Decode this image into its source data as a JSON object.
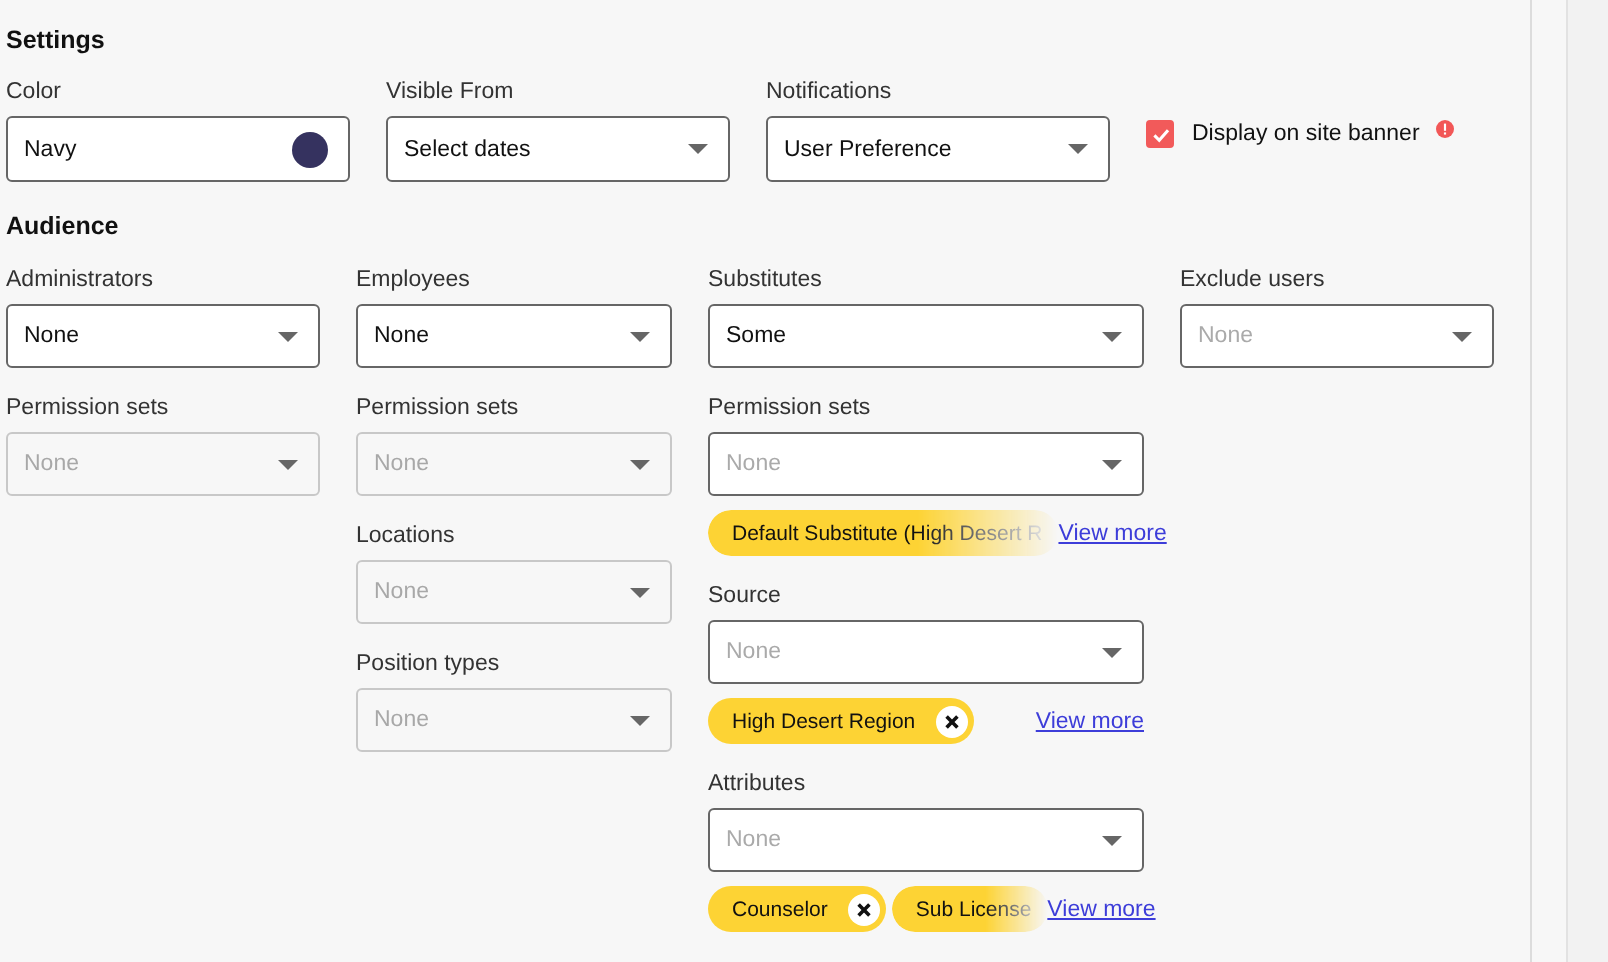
{
  "settings": {
    "title": "Settings",
    "fields": [
      {
        "kind": "color",
        "label": "Color",
        "value": "Navy",
        "color": "#35325f"
      },
      {
        "kind": "select",
        "label": "Visible From",
        "value": "Select dates"
      },
      {
        "kind": "select",
        "label": "Notifications",
        "value": "User Preference"
      }
    ],
    "banner": {
      "label": "Display on site banner",
      "checked": true
    }
  },
  "audience": {
    "title": "Audience",
    "columns": [
      [
        {
          "label": "Administrators",
          "value": "None",
          "disabled": false
        },
        {
          "label": "Permission sets",
          "placeholder": "None",
          "disabled": true
        }
      ],
      [
        {
          "label": "Employees",
          "value": "None",
          "disabled": false
        },
        {
          "label": "Permission sets",
          "placeholder": "None",
          "disabled": true
        },
        {
          "label": "Locations",
          "placeholder": "None",
          "disabled": true
        },
        {
          "label": "Position types",
          "placeholder": "None",
          "disabled": true
        }
      ],
      [
        {
          "label": "Substitutes",
          "value": "Some",
          "disabled": false
        },
        {
          "label": "Permission sets",
          "placeholder": "None",
          "disabled": false,
          "chips": [
            {
              "text": "Default Substitute (High Desert R",
              "removable": false,
              "faded": true
            }
          ],
          "link": "View more"
        },
        {
          "label": "Source",
          "placeholder": "None",
          "disabled": false,
          "chips": [
            {
              "text": "High Desert Region",
              "removable": true,
              "faded": false
            }
          ],
          "link": "View more"
        },
        {
          "label": "Attributes",
          "placeholder": "None",
          "disabled": false,
          "chips": [
            {
              "text": "Counselor",
              "removable": true,
              "faded": false
            },
            {
              "text": "Sub License",
              "removable": false,
              "faded": true
            }
          ],
          "link": "View more"
        }
      ],
      [
        {
          "label": "Exclude users",
          "placeholder": "None",
          "disabled": false
        }
      ]
    ]
  }
}
